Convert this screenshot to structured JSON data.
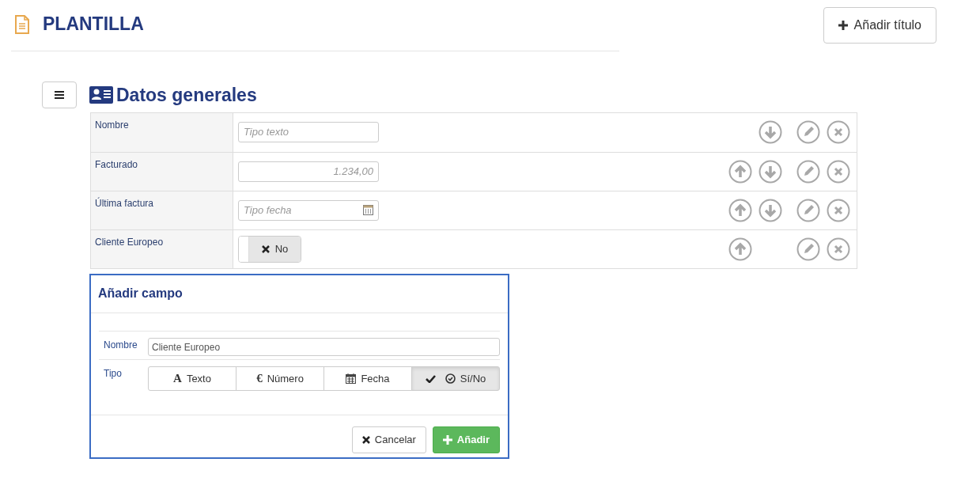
{
  "page": {
    "title": "PLANTILLA",
    "add_title_button": "Añadir título"
  },
  "section": {
    "title": "Datos generales"
  },
  "fields": [
    {
      "label": "Nombre",
      "kind": "text",
      "placeholder": "Tipo texto",
      "can_move_up": false,
      "can_move_down": true
    },
    {
      "label": "Facturado",
      "kind": "number",
      "value": "1.234,00",
      "can_move_up": true,
      "can_move_down": true
    },
    {
      "label": "Última factura",
      "kind": "date",
      "placeholder": "Tipo fecha",
      "can_move_up": true,
      "can_move_down": true
    },
    {
      "label": "Cliente Europeo",
      "kind": "toggle",
      "on": false,
      "toggle_label": "No",
      "can_move_up": true,
      "can_move_down": false
    }
  ],
  "dialog": {
    "title": "Añadir campo",
    "name_label": "Nombre",
    "name_value": "Cliente Europeo",
    "type_label": "Tipo",
    "types": [
      {
        "label": "Texto",
        "kind": "text",
        "glyph": "A",
        "selected": false
      },
      {
        "label": "Número",
        "kind": "number",
        "glyph": "€",
        "selected": false
      },
      {
        "label": "Fecha",
        "kind": "date",
        "selected": false
      },
      {
        "label": "Sí/No",
        "kind": "bool",
        "selected": true
      }
    ],
    "cancel_button": "Cancelar",
    "add_button": "Añadir"
  }
}
